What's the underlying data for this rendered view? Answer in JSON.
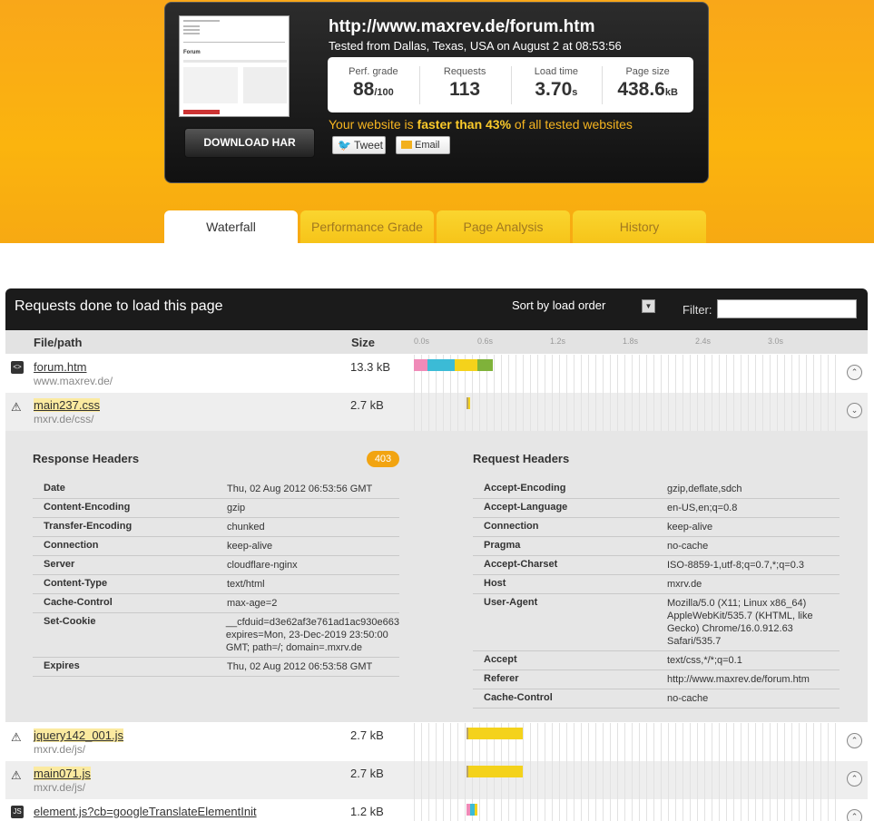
{
  "summary": {
    "url": "http://www.maxrev.de/forum.htm",
    "tested": "Tested from Dallas, Texas, USA on August 2 at 08:53:56",
    "download_har": "DOWNLOAD HAR",
    "thumb_title": "Forum",
    "stats": {
      "perf_label": "Perf. grade",
      "perf_value": "88",
      "perf_unit": "/100",
      "req_label": "Requests",
      "req_value": "113",
      "load_label": "Load time",
      "load_value": "3.70",
      "load_unit": "s",
      "size_label": "Page size",
      "size_value": "438.6",
      "size_unit": "kB"
    },
    "faster_pre": "Your website is ",
    "faster_bold": "faster than 43%",
    "faster_post": " of all tested websites",
    "tweet": "Tweet",
    "email": "Email"
  },
  "tabs": [
    "Waterfall",
    "Performance Grade",
    "Page Analysis",
    "History"
  ],
  "panel": {
    "title": "Requests done to load this page",
    "sort": "Sort by load order",
    "filter_label": "Filter:",
    "col_file": "File/path",
    "col_size": "Size",
    "ticks": [
      "0.0s",
      "0.6s",
      "1.2s",
      "1.8s",
      "2.4s",
      "3.0s"
    ]
  },
  "rows": [
    {
      "name": "forum.htm",
      "path": "www.maxrev.de/",
      "size": "13.3 kB",
      "icon": "html-file-icon",
      "expand": "⌃"
    },
    {
      "name": "main237.css",
      "path": "mxrv.de/css/",
      "size": "2.7 kB",
      "icon": "warning-icon",
      "expand": "⌄"
    },
    {
      "name": "jquery142_001.js",
      "path": "mxrv.de/js/",
      "size": "2.7 kB",
      "icon": "warning-icon",
      "expand": "⌃"
    },
    {
      "name": "main071.js",
      "path": "mxrv.de/js/",
      "size": "2.7 kB",
      "icon": "warning-icon",
      "expand": "⌃"
    },
    {
      "name": "element.js?cb=googleTranslateElementInit",
      "path": "",
      "size": "1.2 kB",
      "icon": "js-file-icon",
      "expand": "⌃"
    }
  ],
  "details": {
    "response_title": "Response Headers",
    "status": "403",
    "request_title": "Request Headers",
    "response": [
      {
        "k": "Date",
        "v": "Thu, 02 Aug 2012 06:53:56 GMT"
      },
      {
        "k": "Content-Encoding",
        "v": "gzip"
      },
      {
        "k": "Transfer-Encoding",
        "v": "chunked"
      },
      {
        "k": "Connection",
        "v": "keep-alive"
      },
      {
        "k": "Server",
        "v": "cloudflare-nginx"
      },
      {
        "k": "Content-Type",
        "v": "text/html"
      },
      {
        "k": "Cache-Control",
        "v": "max-age=2"
      },
      {
        "k": "Set-Cookie",
        "v": "__cfduid=d3e62af3e761ad1ac930e663 expires=Mon, 23-Dec-2019 23:50:00 GMT; path=/; domain=.mxrv.de"
      },
      {
        "k": "Expires",
        "v": "Thu, 02 Aug 2012 06:53:58 GMT"
      }
    ],
    "request": [
      {
        "k": "Accept-Encoding",
        "v": "gzip,deflate,sdch"
      },
      {
        "k": "Accept-Language",
        "v": "en-US,en;q=0.8"
      },
      {
        "k": "Connection",
        "v": "keep-alive"
      },
      {
        "k": "Pragma",
        "v": "no-cache"
      },
      {
        "k": "Accept-Charset",
        "v": "ISO-8859-1,utf-8;q=0.7,*;q=0.3"
      },
      {
        "k": "Host",
        "v": "mxrv.de"
      },
      {
        "k": "User-Agent",
        "v": "Mozilla/5.0 (X11; Linux x86_64) AppleWebKit/535.7 (KHTML, like Gecko) Chrome/16.0.912.63 Safari/535.7"
      },
      {
        "k": "Accept",
        "v": "text/css,*/*;q=0.1"
      },
      {
        "k": "Referer",
        "v": "http://www.maxrev.de/forum.htm"
      },
      {
        "k": "Cache-Control",
        "v": "no-cache"
      }
    ]
  },
  "colors": {
    "dns": "#f08ab8",
    "connect": "#3bbbd6",
    "wait": "#f4d21b",
    "receive": "#7fb23a",
    "blocked": "#b9a36a"
  }
}
